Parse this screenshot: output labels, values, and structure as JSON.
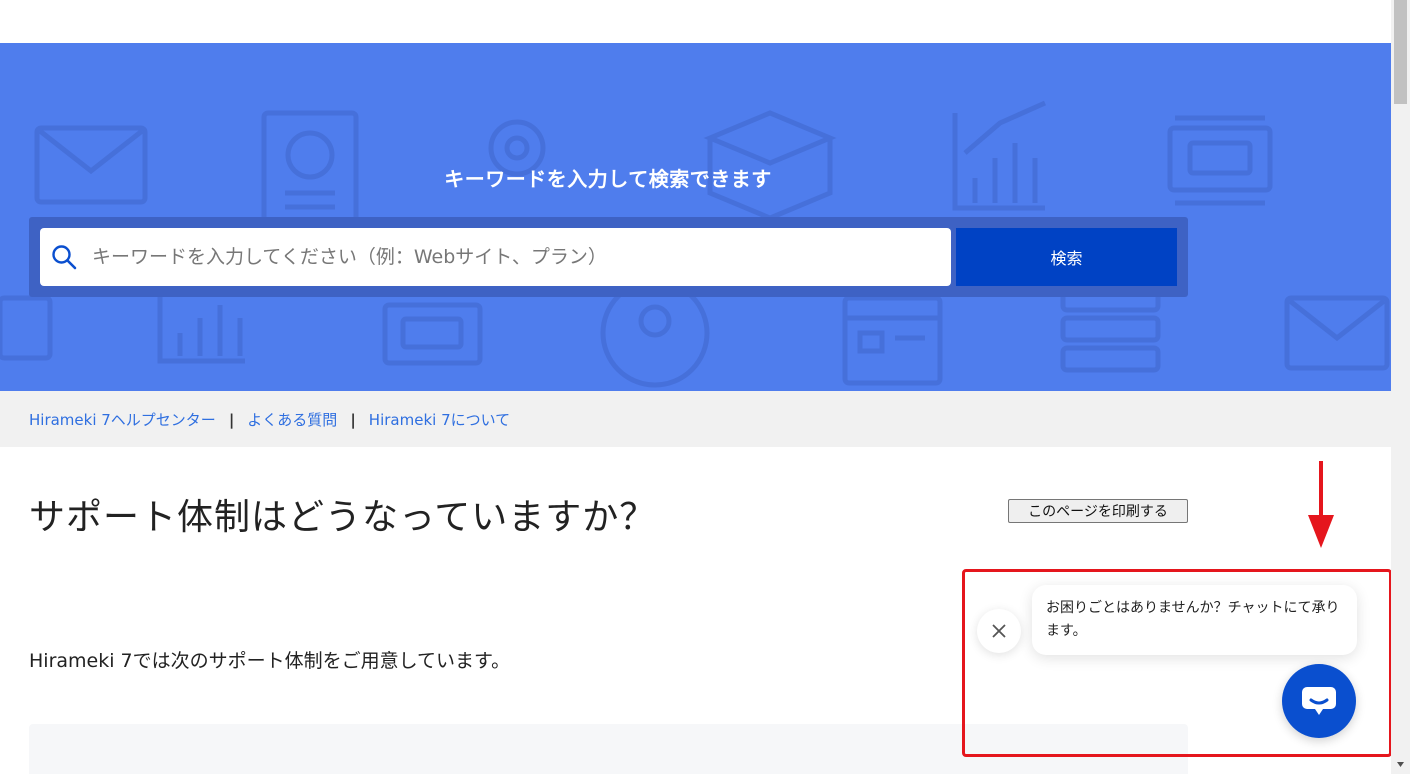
{
  "hero": {
    "title": "キーワードを入力して検索できます",
    "background_color": "#4f7ded",
    "search": {
      "placeholder": "キーワードを入力してください（例：Webサイト、プラン）",
      "value": "",
      "button_label": "検索",
      "icon": "search-icon"
    }
  },
  "breadcrumb": {
    "items": [
      {
        "label": "Hirameki 7ヘルプセンター"
      },
      {
        "label": "よくある質問"
      },
      {
        "label": "Hirameki 7について"
      }
    ],
    "separator": "|"
  },
  "article": {
    "title": "サポート体制はどうなっていますか？",
    "print_button_label": "このページを印刷する",
    "intro": "Hirameki 7では次のサポート体制をご用意しています。"
  },
  "chat_widget": {
    "message": "お困りごとはありませんか？チャットにて承ります。",
    "close_icon": "close-icon",
    "launcher_icon": "chat-icon",
    "accent_color": "#0a4fcf",
    "highlight_color": "#e5161d"
  }
}
